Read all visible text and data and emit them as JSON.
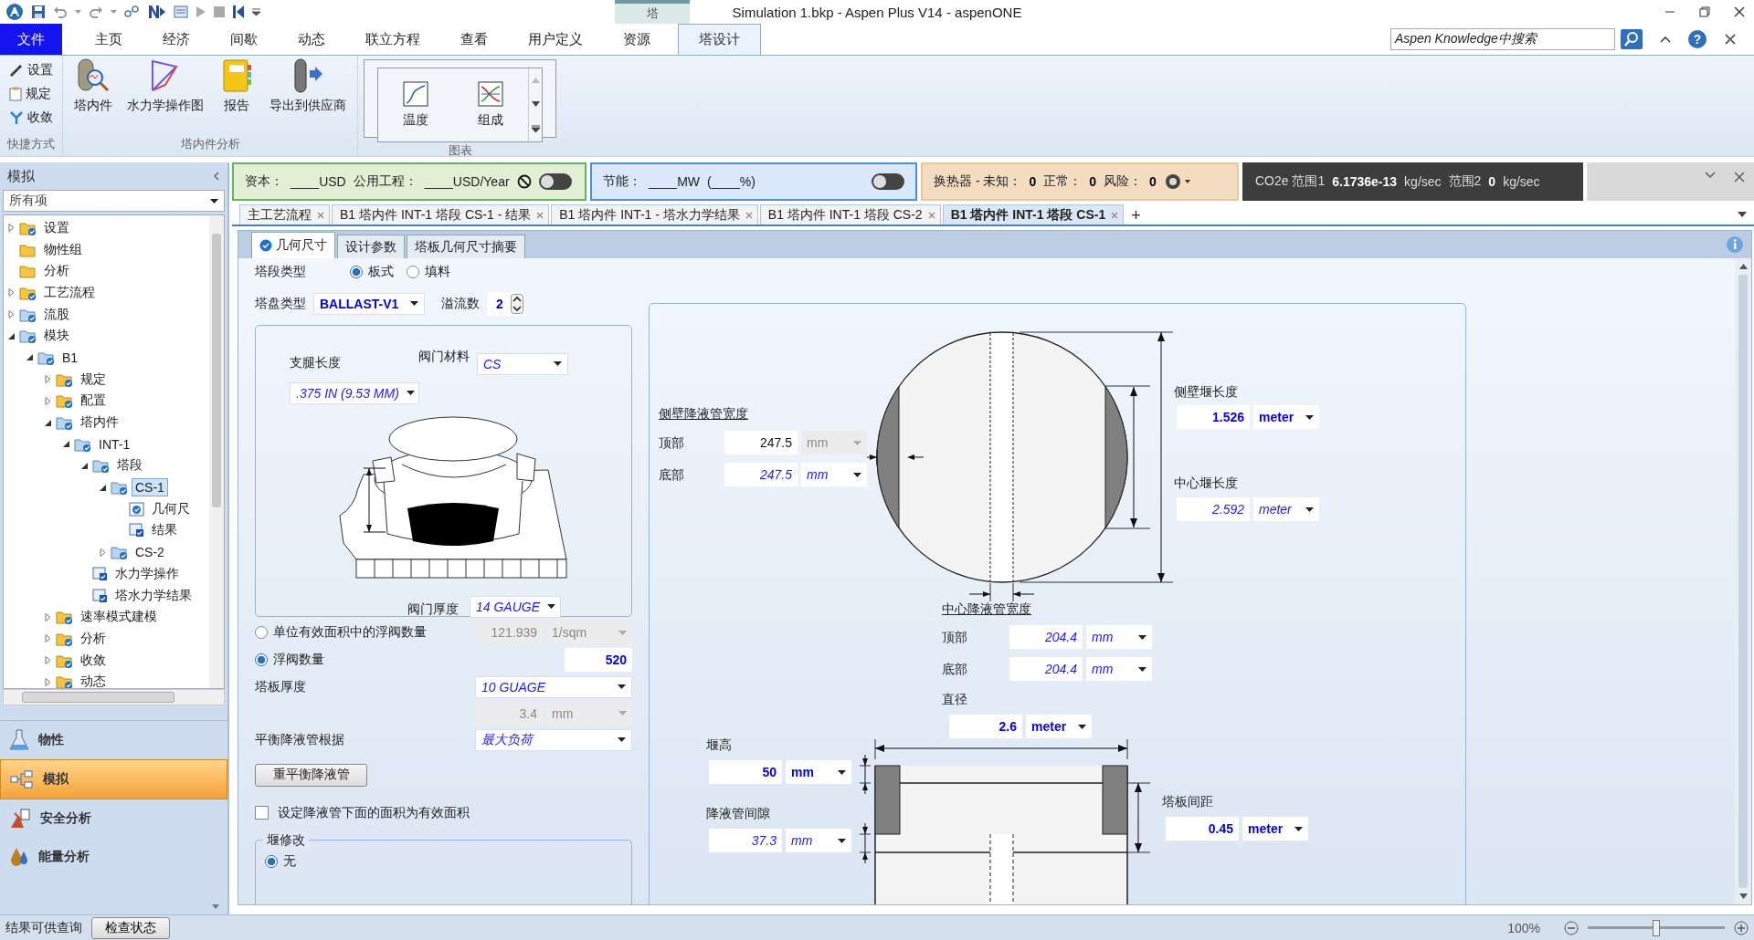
{
  "window": {
    "title": "Simulation 1.bkp - Aspen Plus V14 - aspenONE",
    "context_group": "塔"
  },
  "ribbon_tabs": [
    {
      "label": "文件",
      "kind": "file",
      "selected": false
    },
    {
      "label": "主页",
      "kind": "tab",
      "selected": false
    },
    {
      "label": "经济",
      "kind": "tab",
      "selected": false
    },
    {
      "label": "间歇",
      "kind": "tab",
      "selected": false
    },
    {
      "label": "动态",
      "kind": "tab",
      "selected": false
    },
    {
      "label": "联立方程",
      "kind": "tab",
      "selected": false
    },
    {
      "label": "查看",
      "kind": "tab",
      "selected": false
    },
    {
      "label": "用户定义",
      "kind": "tab",
      "selected": false
    },
    {
      "label": "资源",
      "kind": "tab",
      "selected": false
    },
    {
      "label": "塔设计",
      "kind": "context",
      "selected": true
    }
  ],
  "search": {
    "placeholder": "Aspen Knowledge中搜索"
  },
  "help": "?",
  "ribbon_groups": [
    {
      "title": "快捷方式",
      "kind": "small",
      "items": [
        {
          "label": "设置"
        },
        {
          "label": "规定"
        },
        {
          "label": "收敛"
        }
      ]
    },
    {
      "title": "塔内件分析",
      "kind": "large",
      "items": [
        {
          "label": "塔内件"
        },
        {
          "label": "水力学操作图"
        },
        {
          "label": "报告"
        },
        {
          "label": "导出到供应商"
        }
      ]
    },
    {
      "title": "图表",
      "kind": "gallery",
      "items": [
        {
          "label": "温度"
        },
        {
          "label": "组成"
        }
      ]
    }
  ],
  "navigator": {
    "title": "模拟",
    "filter": "所有项",
    "tree": [
      {
        "label": "设置",
        "kind": "checked-folder",
        "expanded": false,
        "selected": false
      },
      {
        "label": "物性组",
        "kind": "folder",
        "selected": false
      },
      {
        "label": "分析",
        "kind": "folder",
        "selected": false
      },
      {
        "label": "工艺流程",
        "kind": "checked-folder",
        "expanded": false,
        "selected": false
      },
      {
        "label": "流股",
        "kind": "blue-folder",
        "expanded": false,
        "selected": false
      },
      {
        "label": "模块",
        "kind": "blue-folder",
        "expanded": true,
        "selected": false,
        "children": [
          {
            "label": "B1",
            "kind": "blue-folder",
            "expanded": true,
            "selected": false,
            "children": [
              {
                "label": "规定",
                "kind": "checked-folder",
                "expanded": false,
                "selected": false
              },
              {
                "label": "配置",
                "kind": "checked-folder",
                "expanded": false,
                "selected": false
              },
              {
                "label": "塔内件",
                "kind": "blue-folder",
                "expanded": true,
                "selected": false,
                "children": [
                  {
                    "label": "INT-1",
                    "kind": "blue-folder",
                    "expanded": true,
                    "selected": false,
                    "children": [
                      {
                        "label": "塔段",
                        "kind": "blue-folder",
                        "expanded": true,
                        "selected": false,
                        "children": [
                          {
                            "label": "CS-1",
                            "kind": "blue-folder",
                            "expanded": true,
                            "selected": true,
                            "children": [
                              {
                                "label": "几何尺",
                                "kind": "info-form",
                                "selected": false
                              },
                              {
                                "label": "结果",
                                "kind": "checked-form",
                                "selected": false
                              }
                            ]
                          },
                          {
                            "label": "CS-2",
                            "kind": "blue-folder",
                            "expanded": false,
                            "selected": false
                          }
                        ]
                      },
                      {
                        "label": "水力学操作",
                        "kind": "checked-form",
                        "selected": false
                      },
                      {
                        "label": "塔水力学结果",
                        "kind": "checked-form",
                        "selected": false
                      }
                    ]
                  }
                ]
              },
              {
                "label": "速率模式建模",
                "kind": "checked-folder",
                "expanded": false,
                "selected": false
              },
              {
                "label": "分析",
                "kind": "checked-folder",
                "expanded": false,
                "selected": false
              },
              {
                "label": "收敛",
                "kind": "checked-folder",
                "expanded": false,
                "selected": false
              },
              {
                "label": "动态",
                "kind": "checked-folder",
                "expanded": false,
                "selected": false
              }
            ]
          }
        ]
      }
    ]
  },
  "nav_buttons": [
    {
      "label": "物性",
      "selected": false
    },
    {
      "label": "模拟",
      "selected": true
    },
    {
      "label": "安全分析",
      "selected": false
    },
    {
      "label": "能量分析",
      "selected": false
    }
  ],
  "info_bar": [
    {
      "kind": "cost",
      "on": false,
      "texts": [
        {
          "text": "资本：",
          "kind": "label"
        },
        {
          "text": "____USD",
          "kind": "label"
        },
        {
          "text": "公用工程：",
          "kind": "label"
        },
        {
          "text": "____USD/Year",
          "kind": "label"
        }
      ]
    },
    {
      "kind": "energy",
      "on": false,
      "texts": [
        {
          "text": "节能：",
          "kind": "label"
        },
        {
          "text": "____MW",
          "kind": "label"
        },
        {
          "text": "(____%)",
          "kind": "label"
        }
      ]
    },
    {
      "kind": "exchanger",
      "texts": [
        {
          "text": "换热器 - 未知：",
          "kind": "label"
        },
        {
          "text": "0",
          "kind": "value"
        },
        {
          "text": "正常：",
          "kind": "label"
        },
        {
          "text": "0",
          "kind": "value"
        },
        {
          "text": "风险：",
          "kind": "label"
        },
        {
          "text": "0",
          "kind": "value"
        }
      ]
    },
    {
      "kind": "co2",
      "texts": [
        {
          "text": "CO2e 范围1",
          "kind": "label"
        },
        {
          "text": "6.1736e-13",
          "kind": "value"
        },
        {
          "text": "kg/sec",
          "kind": "label"
        },
        {
          "text": "范围2",
          "kind": "label"
        },
        {
          "text": "0",
          "kind": "value"
        },
        {
          "text": "kg/sec",
          "kind": "label"
        }
      ]
    }
  ],
  "doc_tabs": [
    {
      "label": "主工艺流程",
      "selected": false
    },
    {
      "label": "B1 塔内件 INT-1 塔段 CS-1 - 结果",
      "selected": false
    },
    {
      "label": "B1 塔内件 INT-1 - 塔水力学结果",
      "selected": false
    },
    {
      "label": "B1 塔内件 INT-1 塔段 CS-2",
      "selected": false
    },
    {
      "label": "B1 塔内件 INT-1 塔段 CS-1",
      "selected": true
    }
  ],
  "new_tab": "+",
  "form_tabs": [
    {
      "label": "几何尺寸",
      "selected": true,
      "complete": true
    },
    {
      "label": "设计参数",
      "selected": false,
      "complete": false
    },
    {
      "label": "塔板几何尺寸摘要",
      "selected": false,
      "complete": false
    }
  ],
  "section_type": {
    "label": "塔段类型",
    "options": [
      {
        "label": "板式",
        "selected": true
      },
      {
        "label": "填料",
        "selected": false
      }
    ]
  },
  "tray_type": {
    "label": "塔盘类型",
    "value": {
      "text": "BALLAST-V1",
      "kind": "entered"
    }
  },
  "passes": {
    "label": "溢流数",
    "value": {
      "text": "2",
      "kind": "entered"
    }
  },
  "valve": {
    "leg_length": {
      "label": "支腿长度",
      "value": {
        "text": ".375 IN (9.53 MM)",
        "kind": "default"
      }
    },
    "material": {
      "label": "阀门材料",
      "value": {
        "text": "CS",
        "kind": "default"
      }
    },
    "thickness": {
      "label": "阀门厚度",
      "value": {
        "text": "14 GAUGE",
        "kind": "default"
      }
    }
  },
  "valve_count_options": [
    {
      "label": "单位有效面积中的浮阀数量",
      "selected": false,
      "value": {
        "text": "121.939",
        "kind": "disabled"
      },
      "unit": {
        "text": "1/sqm",
        "kind": "disabled"
      }
    },
    {
      "label": "浮阀数量",
      "selected": true,
      "value": {
        "text": "520",
        "kind": "entered"
      }
    }
  ],
  "tray_thickness": {
    "label": "塔板厚度",
    "gauge": {
      "text": "10 GUAGE",
      "kind": "default"
    },
    "value": {
      "text": "3.4",
      "kind": "disabled"
    },
    "unit": {
      "text": "mm",
      "kind": "disabled"
    }
  },
  "balance_basis": {
    "label": "平衡降液管根据",
    "value": {
      "text": "最大负荷",
      "kind": "default"
    }
  },
  "rebalance_button": "重平衡降液管",
  "area_checkbox": {
    "label": "设定降液管下面的面积为有效面积",
    "checked": false
  },
  "weir_mod": {
    "title": "堰修改",
    "options": [
      {
        "label": "无",
        "selected": true
      }
    ]
  },
  "side_downcomer": {
    "title": "侧壁降液管宽度",
    "top": {
      "label": "顶部",
      "value": {
        "text": "247.5",
        "kind": "calculated"
      },
      "unit": {
        "text": "mm",
        "kind": "disabled"
      }
    },
    "bottom": {
      "label": "底部",
      "value": {
        "text": "247.5",
        "kind": "default"
      },
      "unit": {
        "text": "mm",
        "kind": "default"
      }
    }
  },
  "side_weir_length": {
    "label": "侧壁堰长度",
    "value": {
      "text": "1.526",
      "kind": "entered"
    },
    "unit": {
      "text": "meter",
      "kind": "entered"
    }
  },
  "center_weir_length": {
    "label": "中心堰长度",
    "value": {
      "text": "2.592",
      "kind": "default"
    },
    "unit": {
      "text": "meter",
      "kind": "default"
    }
  },
  "center_downcomer": {
    "title": "中心降液管宽度",
    "top": {
      "label": "顶部",
      "value": {
        "text": "204.4",
        "kind": "default"
      },
      "unit": {
        "text": "mm",
        "kind": "default"
      }
    },
    "bottom": {
      "label": "底部",
      "value": {
        "text": "204.4",
        "kind": "default"
      },
      "unit": {
        "text": "mm",
        "kind": "default"
      }
    }
  },
  "diameter": {
    "label": "直径",
    "value": {
      "text": "2.6",
      "kind": "entered"
    },
    "unit": {
      "text": "meter",
      "kind": "entered"
    }
  },
  "weir_height": {
    "label": "堰高",
    "value": {
      "text": "50",
      "kind": "entered"
    },
    "unit": {
      "text": "mm",
      "kind": "entered"
    }
  },
  "downcomer_clearance": {
    "label": "降液管间隙",
    "value": {
      "text": "37.3",
      "kind": "default"
    },
    "unit": {
      "text": "mm",
      "kind": "default"
    }
  },
  "tray_spacing": {
    "label": "塔板间距",
    "value": {
      "text": "0.45",
      "kind": "entered"
    },
    "unit": {
      "text": "meter",
      "kind": "entered"
    }
  },
  "status_bar": {
    "message": "结果可供查询",
    "button": "检查状态",
    "zoom": "100%",
    "zoom_slider": {
      "level": 0.5
    }
  }
}
